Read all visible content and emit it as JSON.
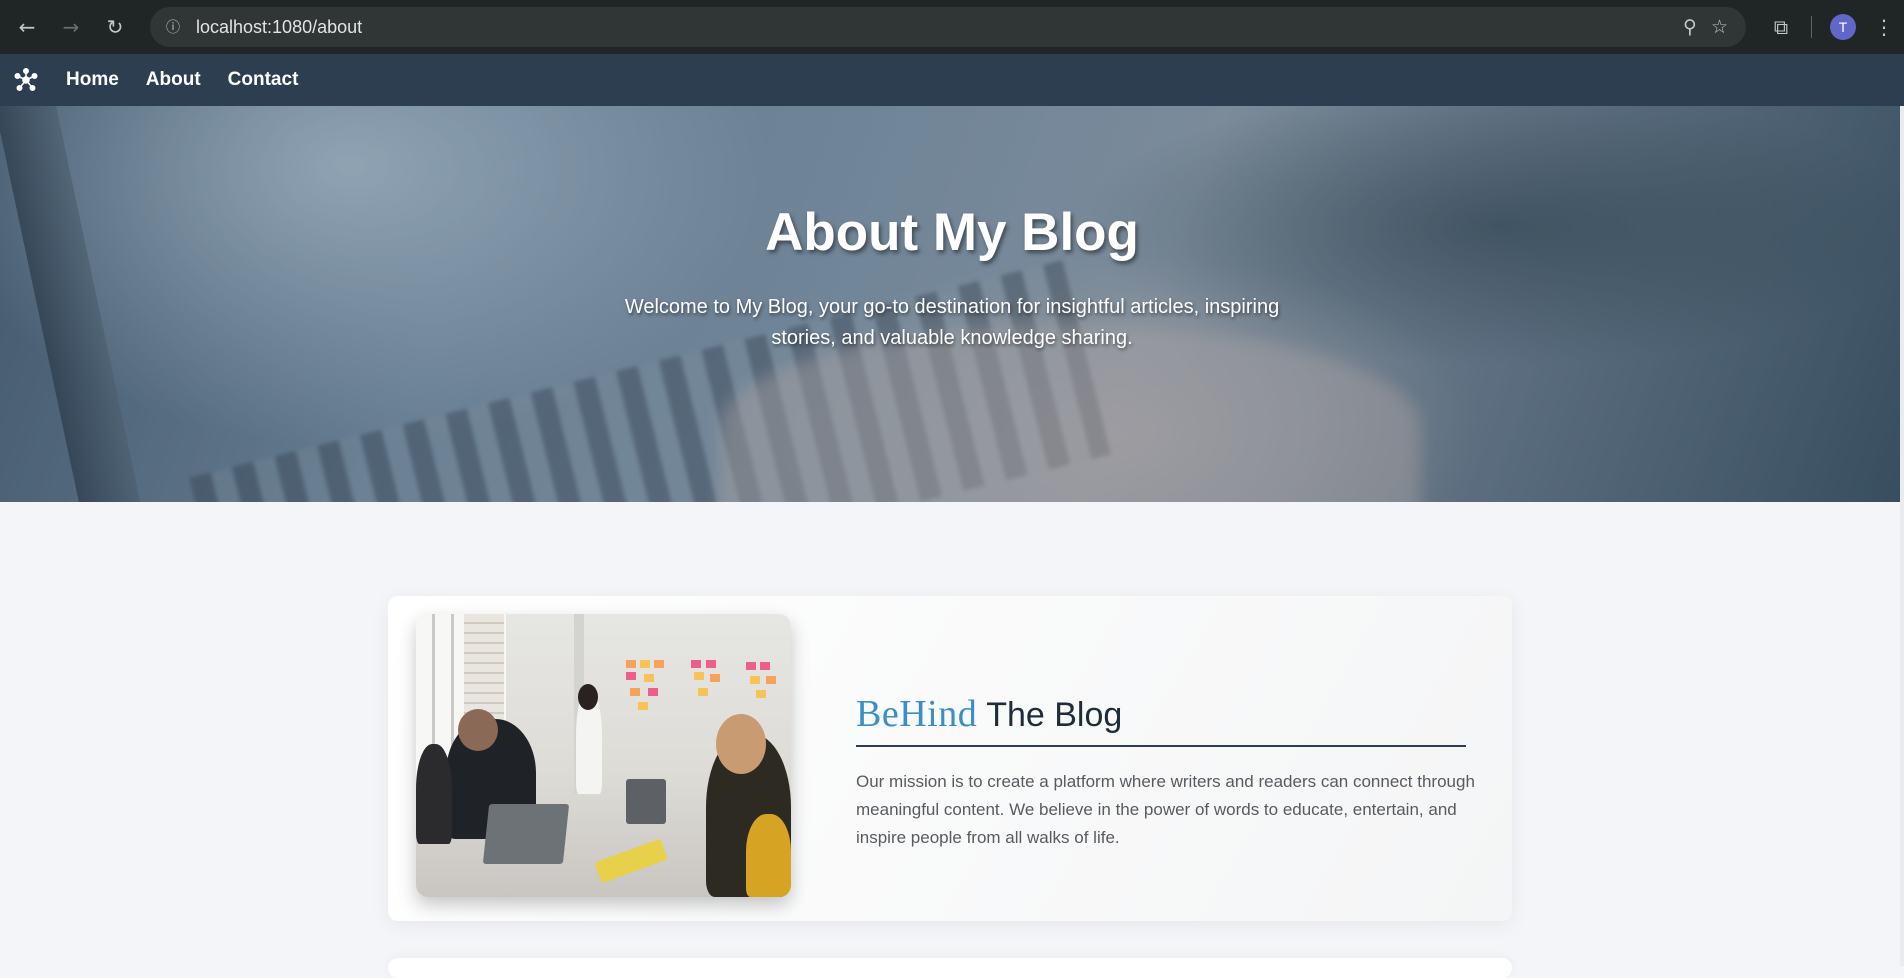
{
  "browser": {
    "url": "localhost:1080/about",
    "profile_initial": "T",
    "icons": [
      "back-icon",
      "forward-icon",
      "reload-icon",
      "site-info-icon",
      "zoom-icon",
      "bookmark-star-icon",
      "extensions-icon",
      "menu-kebab-icon"
    ]
  },
  "nav": {
    "links": [
      {
        "label": "Home"
      },
      {
        "label": "About"
      },
      {
        "label": "Contact"
      }
    ]
  },
  "hero": {
    "title": "About My Blog",
    "subtitle": "Welcome to My Blog, your go-to destination for insightful articles, inspiring stories, and valuable knowledge sharing."
  },
  "section": {
    "heading_accent": "BeHind",
    "heading_rest": "The Blog",
    "paragraph": "Our mission is to create a platform where writers and readers can connect through meaningful content. We believe in the power of words to educate, entertain, and inspire people from all walks of life."
  },
  "colors": {
    "nav_bg": "#2c3e50",
    "accent_blue": "#3a8fc9",
    "heading_dark": "#1f2d3b",
    "page_bg": "#f3f5f8"
  }
}
